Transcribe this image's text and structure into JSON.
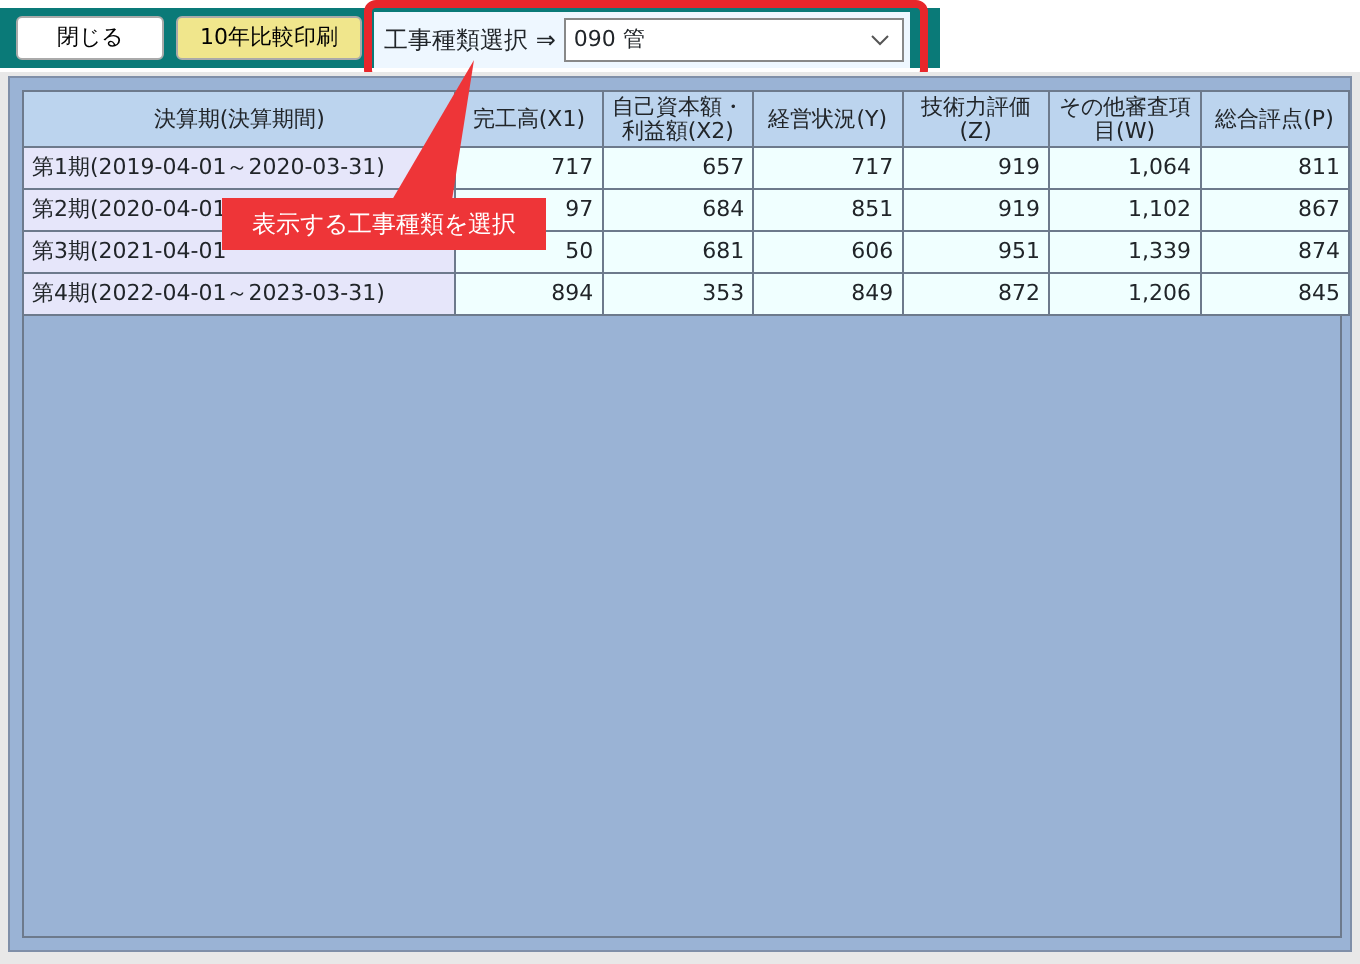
{
  "toolbar": {
    "buttons": [
      {
        "label": "閉じる",
        "kind": "plain"
      },
      {
        "label": "10年比較印刷",
        "kind": "print"
      }
    ]
  },
  "type_selector": {
    "label": "工事種類選択 ⇒",
    "value": "090 管"
  },
  "table": {
    "columns": [
      "決算期(決算期間)",
      "完工高(X1)",
      "自己資本額・利益額(X2)",
      "経営状況(Y)",
      "技術力評価(Z)",
      "その他審査項目(W)",
      "総合評点(P)"
    ],
    "rows": [
      [
        "第1期(2019-04-01～2020-03-31)",
        "717",
        "657",
        "717",
        "919",
        "1,064",
        "811"
      ],
      [
        "第2期(2020-04-01",
        "97",
        "684",
        "851",
        "919",
        "1,102",
        "867"
      ],
      [
        "第3期(2021-04-01",
        "50",
        "681",
        "606",
        "951",
        "1,339",
        "874"
      ],
      [
        "第4期(2022-04-01～2023-03-31)",
        "894",
        "353",
        "849",
        "872",
        "1,206",
        "845"
      ]
    ]
  },
  "callout": {
    "text": "表示する工事種類を選択"
  }
}
